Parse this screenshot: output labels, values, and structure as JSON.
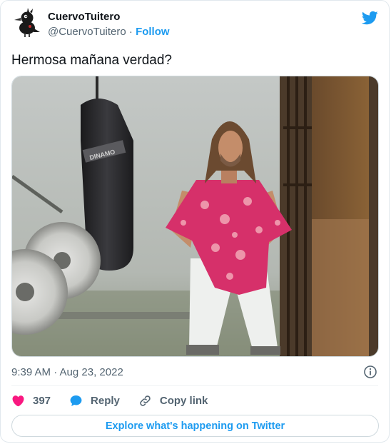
{
  "author": {
    "name": "CuervoTuitero",
    "handle": "@CuervoTuitero",
    "separator": "·",
    "follow_label": "Follow"
  },
  "tweet": {
    "text": "Hermosa mañana verdad?",
    "timestamp": "9:39 AM · Aug 23, 2022"
  },
  "media": {
    "sign_text": "DINAMO"
  },
  "actions": {
    "like_count": "397",
    "reply_label": "Reply",
    "copy_link_label": "Copy link"
  },
  "explore_label": "Explore what's happening on Twitter",
  "icons": {
    "brand": "twitter-bird-icon",
    "like": "heart-icon",
    "reply": "speech-bubble-icon",
    "copy": "link-icon",
    "info": "info-icon"
  },
  "colors": {
    "brand_blue": "#1d9bf0",
    "like_red": "#f91880",
    "text_primary": "#0f1419",
    "text_secondary": "#536471"
  }
}
